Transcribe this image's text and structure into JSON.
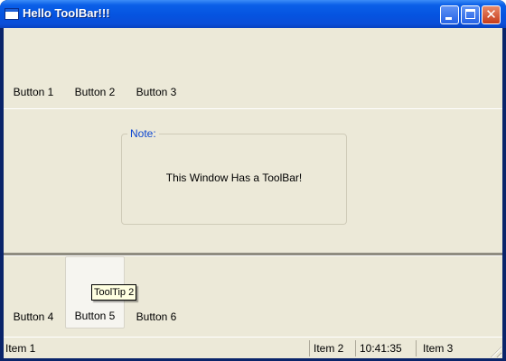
{
  "window": {
    "title": "Hello ToolBar!!!"
  },
  "toolbar_top": {
    "buttons": [
      "Button 1",
      "Button 2",
      "Button 3"
    ]
  },
  "note": {
    "legend": "Note:",
    "message": "This Window Has a ToolBar!"
  },
  "toolbar_bottom": {
    "buttons": [
      "Button 4",
      "Button 5",
      "Button 6"
    ],
    "hovered": "Button 5"
  },
  "tooltip": {
    "text": "ToolTip 2"
  },
  "statusbar": {
    "item1": "Item 1",
    "item2": "Item 2",
    "time": "10:41:35",
    "item3": "Item 3"
  },
  "colors": {
    "titlebar": "#0553e0",
    "client": "#ece9d8",
    "legend": "#0b45d0",
    "tooltip_bg": "#ffffe1"
  },
  "icons": {
    "window": "app-window-icon",
    "minimize": "minimize-icon",
    "maximize": "maximize-icon",
    "close": "close-icon",
    "grip": "resize-grip-icon"
  }
}
